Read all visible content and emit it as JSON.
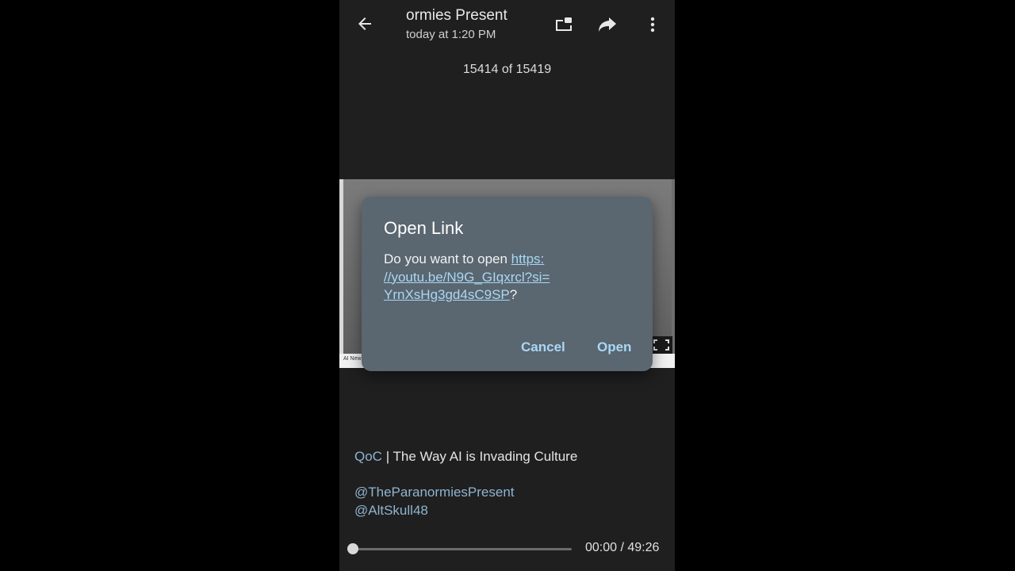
{
  "header": {
    "back_icon": "arrow-left-icon",
    "title": "ormies Present",
    "subtitle": "today at 1:20 PM",
    "pip_icon": "picture-in-picture-icon",
    "share_icon": "share-arrow-icon",
    "more_icon": "more-vertical-icon"
  },
  "counter": "15414 of 15419",
  "media": {
    "strip_text": "AI News"
  },
  "dialog": {
    "title": "Open Link",
    "prompt": "Do you want to open ",
    "link_part1": "https:",
    "link_part2": "//youtu.be/N9G_GIqxrcl?si=",
    "link_part3": "YrnXsHg3gd4sC9SP",
    "suffix": "?",
    "cancel_label": "Cancel",
    "open_label": "Open"
  },
  "caption": {
    "tag": "QoC",
    "separator": " | ",
    "headline": "The Way AI is Invading Culture",
    "mention1": "@TheParanormiesPresent",
    "mention2": "@AltSkull48"
  },
  "player": {
    "time": "00:00 / 49:26",
    "progress": 0
  },
  "colors": {
    "background": "#1f1f1f",
    "dialog": "#5a6670",
    "accent_link": "#a8d8f5",
    "mention": "#8fb4d0"
  }
}
